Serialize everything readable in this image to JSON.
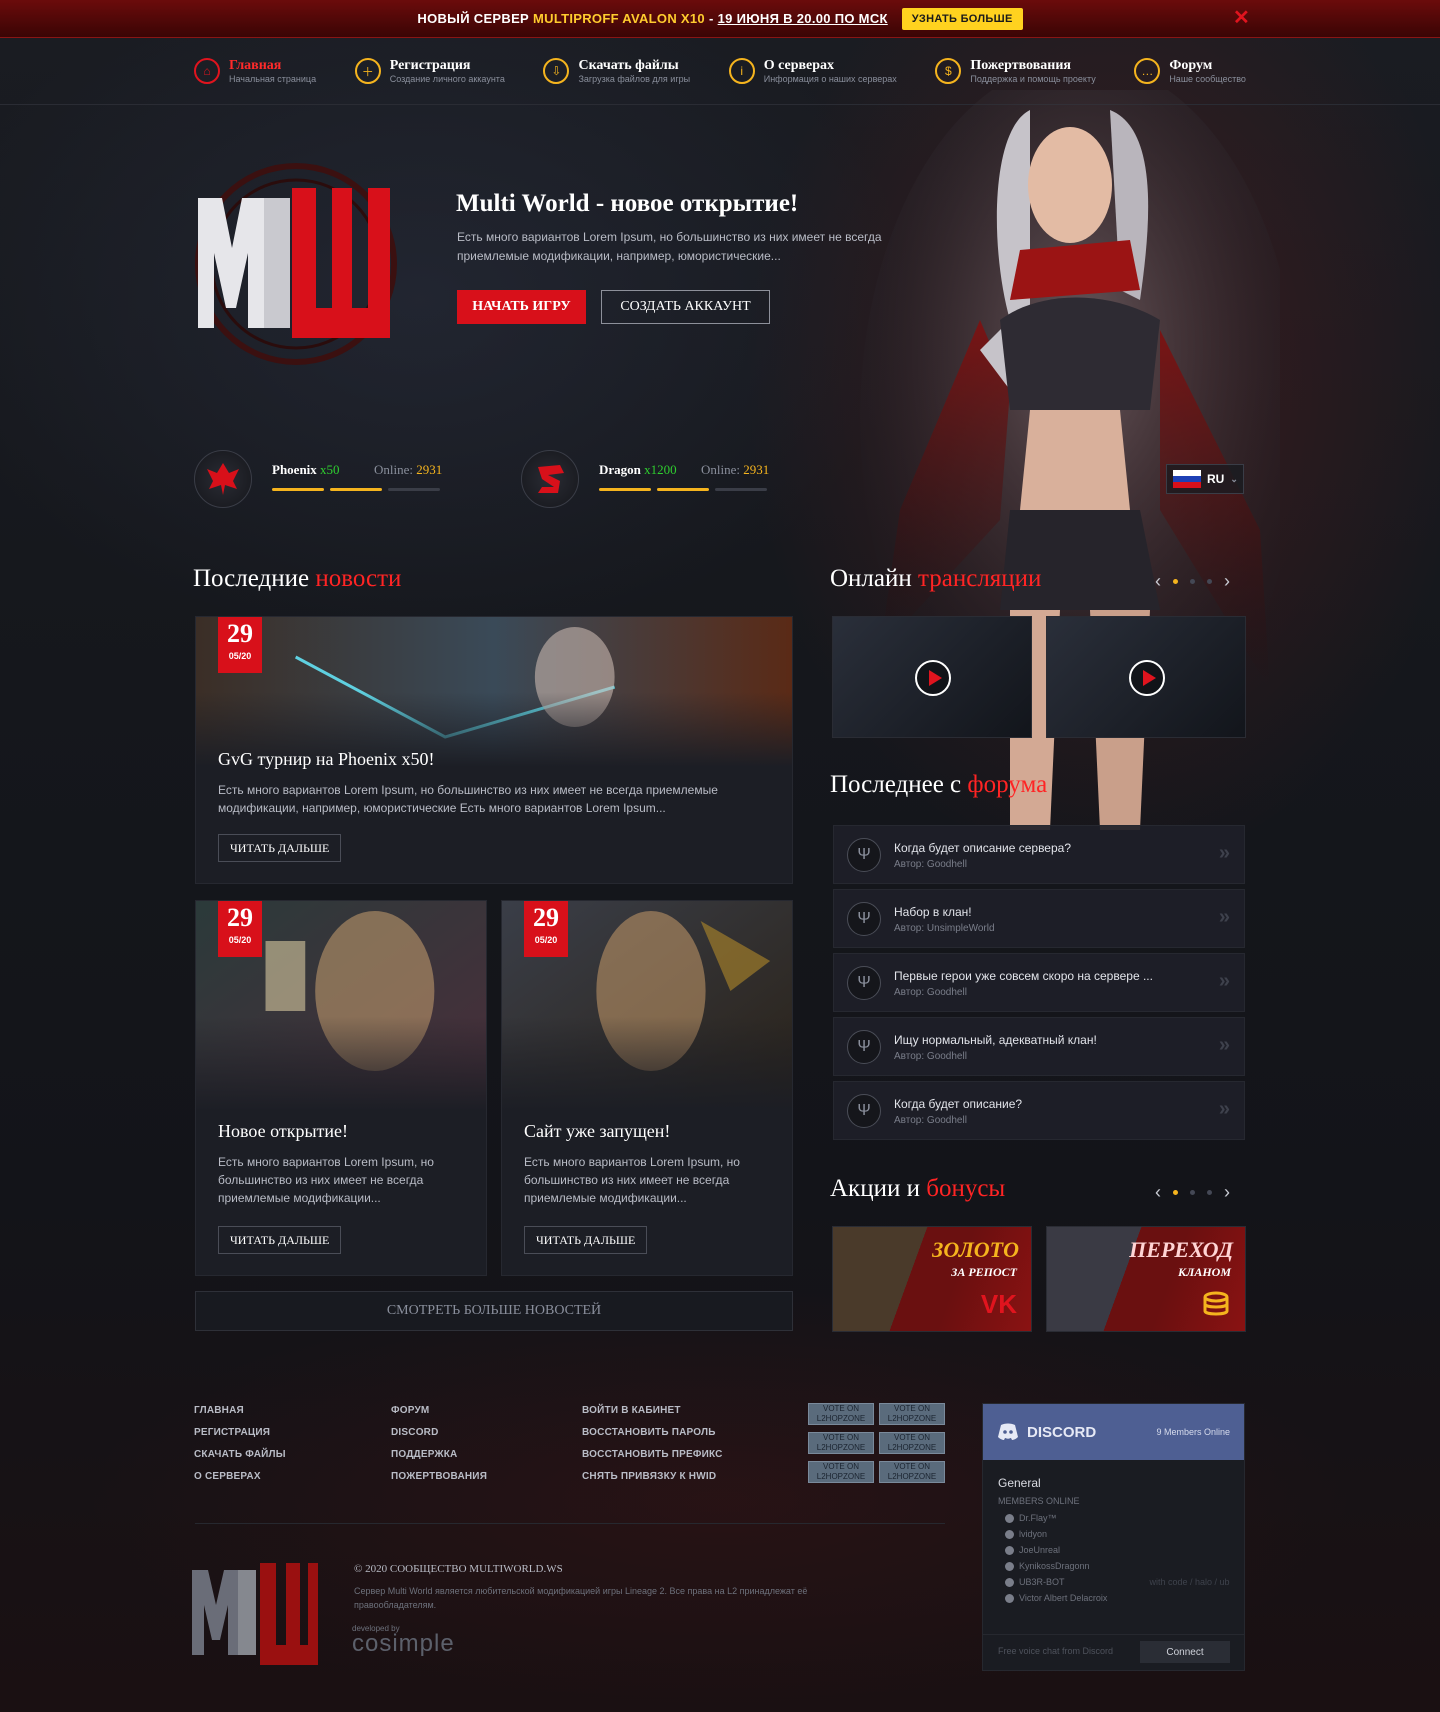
{
  "banner": {
    "prefix": "НОВЫЙ СЕРВЕР",
    "highlight": "MULTIPROFF AVALON X10",
    "dash": "-",
    "date": "19 ИЮНЯ В 20.00 ПО МСК",
    "button": "УЗНАТЬ БОЛЬШЕ",
    "close": "✕"
  },
  "nav": [
    {
      "title": "Главная",
      "sub": "Начальная страница",
      "icon": "home-icon",
      "glyph": "⌂"
    },
    {
      "title": "Регистрация",
      "sub": "Создание личного аккаунта",
      "icon": "user-add-icon",
      "glyph": "＋"
    },
    {
      "title": "Скачать файлы",
      "sub": "Загрузка файлов для игры",
      "icon": "download-icon",
      "glyph": "⇩"
    },
    {
      "title": "О серверах",
      "sub": "Информация о наших серверах",
      "icon": "info-icon",
      "glyph": "i"
    },
    {
      "title": "Пожертвования",
      "sub": "Поддержка и помощь проекту",
      "icon": "coin-icon",
      "glyph": "$"
    },
    {
      "title": "Форум",
      "sub": "Наше сообщество",
      "icon": "chat-icon",
      "glyph": "…"
    }
  ],
  "hero": {
    "title": "Multi World - новое открытие!",
    "text": "Есть много вариантов Lorem Ipsum, но большинство из них имеет не всегда приемлемые модификации, например, юмористические...",
    "start": "НАЧАТЬ ИГРУ",
    "create": "СОЗДАТЬ АККАУНТ"
  },
  "servers": [
    {
      "name": "Phoenix",
      "rate": "x50",
      "online_label": "Online:",
      "online": "2931",
      "load": [
        1,
        1,
        0
      ]
    },
    {
      "name": "Dragon",
      "rate": "x1200",
      "online_label": "Online:",
      "online": "2931",
      "load": [
        1,
        1,
        0
      ]
    }
  ],
  "lang": "RU",
  "news_head": {
    "a": "Последние",
    "b": "новости"
  },
  "news": [
    {
      "day": "29",
      "month": "05/20",
      "title": "GvG турнир на Phoenix x50!",
      "text": "Есть много вариантов Lorem Ipsum, но большинство из них имеет не всегда приемлемые модификации, например, юмористические Есть много вариантов Lorem Ipsum...",
      "more": "ЧИТАТЬ ДАЛЬШЕ"
    },
    {
      "day": "29",
      "month": "05/20",
      "title": "Новое открытие!",
      "text": "Есть много вариантов Lorem Ipsum, но большинство из них имеет не всегда приемлемые модификации...",
      "more": "ЧИТАТЬ ДАЛЬШЕ"
    },
    {
      "day": "29",
      "month": "05/20",
      "title": "Сайт уже запущен!",
      "text": "Есть много вариантов Lorem Ipsum, но большинство из них имеет не всегда приемлемые модификации...",
      "more": "ЧИТАТЬ ДАЛЬШЕ"
    }
  ],
  "all_news": "СМОТРЕТЬ БОЛЬШЕ НОВОСТЕЙ",
  "streams_head": {
    "a": "Онлайн",
    "b": "трансляции"
  },
  "forum_head": {
    "a": "Последнее с",
    "b": "форума"
  },
  "forum": [
    {
      "title": "Когда будет описание сервера?",
      "author": "Автор: Goodhell"
    },
    {
      "title": "Набор в клан!",
      "author": "Автор: UnsimpleWorld"
    },
    {
      "title": "Первые герои уже совсем скоро на сервере ...",
      "author": "Автор: Goodhell"
    },
    {
      "title": "Ищу нормальный, адекватный клан!",
      "author": "Автор: Goodhell"
    },
    {
      "title": "Когда будет описание?",
      "author": "Автор: Goodhell"
    }
  ],
  "promo_head": {
    "a": "Акции и",
    "b": "бонусы"
  },
  "promos": [
    {
      "big": "ЗОЛОТО",
      "small": "ЗА РЕПОСТ",
      "mark": "VK"
    },
    {
      "big": "ПЕРЕХОД",
      "small": "КЛАНОМ",
      "mark": "coins"
    }
  ],
  "footer": {
    "col1": [
      "ГЛАВНАЯ",
      "РЕГИСТРАЦИЯ",
      "СКАЧАТЬ ФАЙЛЫ",
      "О СЕРВЕРАХ"
    ],
    "col2": [
      "ФОРУМ",
      "DISCORD",
      "ПОДДЕРЖКА",
      "ПОЖЕРТВОВАНИЯ"
    ],
    "col3": [
      "ВОЙТИ В КАБИНЕТ",
      "ВОССТАНОВИТЬ ПАРОЛЬ",
      "ВОССТАНОВИТЬ ПРЕФИКС",
      "СНЯТЬ ПРИВЯЗКУ К HWID"
    ],
    "vote_a": "VOTE ON",
    "vote_b": "L2HOPZONE",
    "copyright": "© 2020 СООБЩЕСТВО MULTIWORLD.WS",
    "legal": "Сервер Multi World является любительской модификацией игры Lineage 2. Все права на L2 принадлежат её правообладателям.",
    "dev_label": "developed by",
    "dev_name": "cosimple"
  },
  "discord": {
    "name": "DISCORD",
    "members": "9 Members Online",
    "channel": "General",
    "members_label": "MEMBERS ONLINE",
    "list": [
      "Dr.Flay™",
      "lvidyon",
      "JoeUnreal",
      "KynikossDragonn",
      "UB3R-BOT",
      "Victor Albert Delacroix"
    ],
    "bot_tag": "with code / halo / ub",
    "footer": "Free voice chat from Discord",
    "connect": "Connect"
  },
  "colors": {
    "accent": "#d8101a",
    "gold": "#f5b41e",
    "online_green": "#2fce2f",
    "discord": "#4e5f93"
  }
}
